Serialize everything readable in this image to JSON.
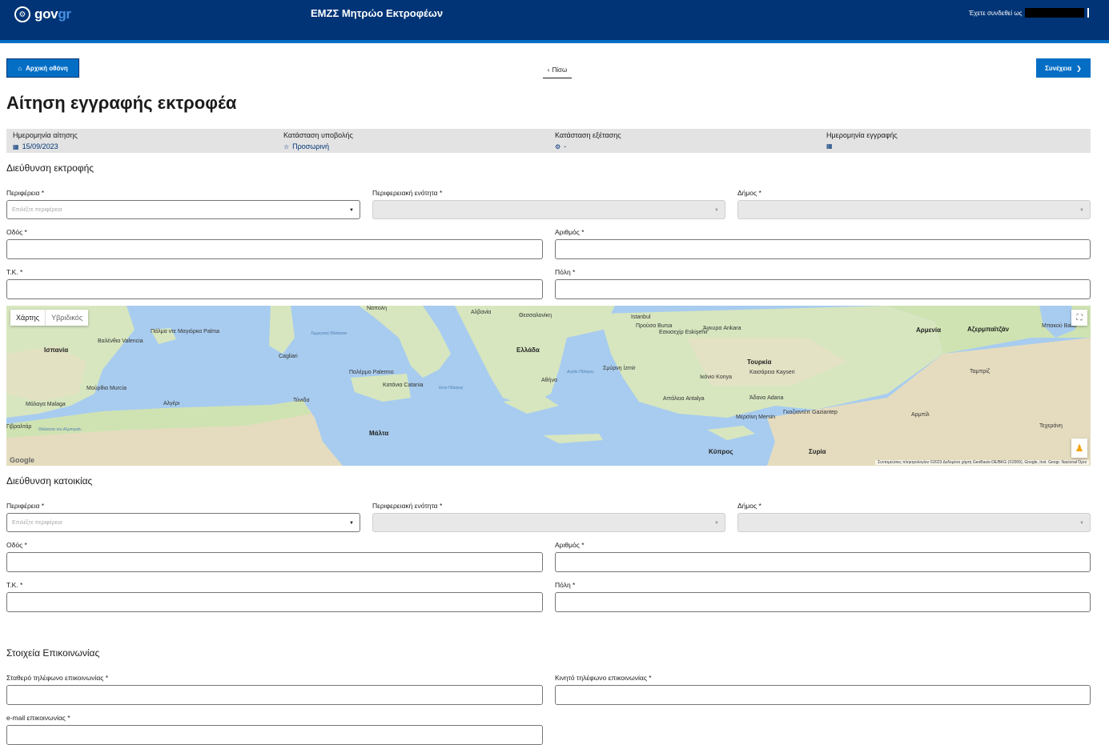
{
  "header": {
    "logo_text_gov": "gov",
    "logo_text_gr": "gr",
    "app_title": "ΕΜΖΣ Μητρώο Εκτροφέων",
    "user_label": "Έχετε συνδεθεί ως"
  },
  "nav": {
    "home_label": "Αρχική οθόνη",
    "back_label": "Πίσω",
    "next_label": "Συνέχεια"
  },
  "page_title": "Αίτηση εγγραφής εκτροφέα",
  "summary": {
    "application_date_label": "Ημερομηνία αίτησης",
    "application_date_value": "15/09/2023",
    "submission_status_label": "Κατάσταση υποβολής",
    "submission_status_value": "Προσωρινή",
    "review_status_label": "Κατάσταση εξέτασης",
    "review_status_value": "-",
    "registration_date_label": "Ημερομηνία εγγραφής",
    "registration_date_value": ""
  },
  "farm_address": {
    "title": "Διεύθυνση εκτροφής",
    "region_label": "Περιφέρεια *",
    "region_placeholder": "Επιλέξτε περιφέρεια",
    "regional_unit_label": "Περιφερειακή ενότητα *",
    "municipality_label": "Δήμος *",
    "street_label": "Οδός *",
    "number_label": "Αριθμός *",
    "postal_code_label": "Τ.Κ. *",
    "city_label": "Πόλη *"
  },
  "map": {
    "type_map": "Χάρτης",
    "type_hybrid": "Υβριδικός",
    "google": "Google",
    "attribution": "Συντομεύσεις πληκτρολογίου   ©2023 Δεδομένα χάρτη GeoBasis-DE/BKG (©2009), Google, Inst. Geogr. Nacional   Όροι",
    "labels": {
      "spain": "Ισπανία",
      "valencia": "Βαλένθια Valencia",
      "palma": "Πάλμα ντε Μαγιόρκα Palma",
      "murcia": "Μούρθια Murcia",
      "malaga": "Μάλαγα Malaga",
      "algeria": "Αλγέρι",
      "tunis": "Τύνιδα",
      "gibraltar": "Γιβραλτάρ",
      "naples": "Νάπολη",
      "sardinia": "Cagliari",
      "palermo": "Παλέρμο Palermo",
      "catania": "Κατάνια Catania",
      "malta": "Μάλτα",
      "albania": "Αλβανία",
      "thessaloniki": "Θεσσαλονίκη",
      "greece": "Ελλάδα",
      "athens": "Αθήνα",
      "istanbul": "Istanbul",
      "bursa": "Προύσα Bursa",
      "eskisehir": "Εσκισεχίρ Eskişehir",
      "ankara": "Άγκυρα Ankara",
      "izmir": "Σμύρνη İzmir",
      "turkey": "Τουρκία",
      "konya": "Ικόνιο Konya",
      "kayseri": "Καισάρεια Kayseri",
      "antalya": "Αττάλεια Antalya",
      "adana": "Άδανα Adana",
      "mersin": "Μερσίνη Mersin",
      "gaziantep": "Γκαζιαντέπ Gaziantep",
      "cyprus": "Κύπρος",
      "syria": "Συρία",
      "armenia": "Αρμενία",
      "azerbaijan": "Αζερμπαϊτζάν",
      "baku": "Μπακού Baku",
      "tabriz": "Ταμπρίζ",
      "tehran": "Τεχεράνη",
      "erbil": "Αρμπίλ",
      "tyrrhenian": "Τυρρηνική Θάλασσα",
      "ionian": "Ιόνιο Πέλαγος",
      "aegean": "Αιγαίο Πέλαγος",
      "alboran": "Θάλασσα του Αλμποράν"
    }
  },
  "home_address": {
    "title": "Διεύθυνση κατοικίας",
    "region_label": "Περιφέρεια *",
    "region_placeholder": "Επιλέξτε περιφέρεια",
    "regional_unit_label": "Περιφερειακή ενότητα *",
    "municipality_label": "Δήμος *",
    "street_label": "Οδός *",
    "number_label": "Αριθμός *",
    "postal_code_label": "Τ.Κ. *",
    "city_label": "Πόλη *"
  },
  "contact": {
    "title": "Στοιχεία Επικοινωνίας",
    "landline_label": "Σταθερό τηλέφωνο επικοινωνίας *",
    "mobile_label": "Κινητό τηλέφωνο επικοινωνίας *",
    "email_label": "e-mail επικοινωνίας *"
  },
  "colors": {
    "header_bg": "#003476",
    "accent": "#046ec5",
    "summary_bg": "#e3e3e3",
    "disabled_bg": "#e8e8e8"
  }
}
